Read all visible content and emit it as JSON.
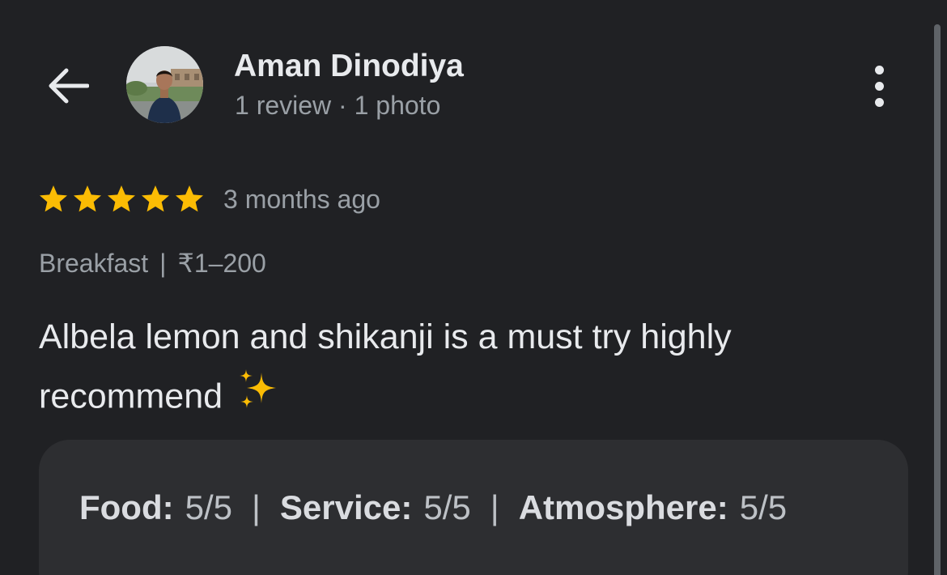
{
  "header": {
    "reviewer_name": "Aman Dinodiya",
    "reviewer_meta": "1 review · 1 photo"
  },
  "review": {
    "rating": 5,
    "max_rating": 5,
    "time_ago": "3 months ago",
    "tags": [
      "Breakfast",
      "₹1–200"
    ],
    "text": "Albela lemon and shikanji is a must try highly recommend",
    "emoji": "sparkles-icon"
  },
  "subratings": [
    {
      "label": "Food:",
      "value": "5/5"
    },
    {
      "label": "Service:",
      "value": "5/5"
    },
    {
      "label": "Atmosphere:",
      "value": "5/5"
    }
  ],
  "colors": {
    "background": "#202124",
    "star": "#fbbc04",
    "card": "#2d2e31",
    "secondary_text": "#9aa0a6"
  }
}
